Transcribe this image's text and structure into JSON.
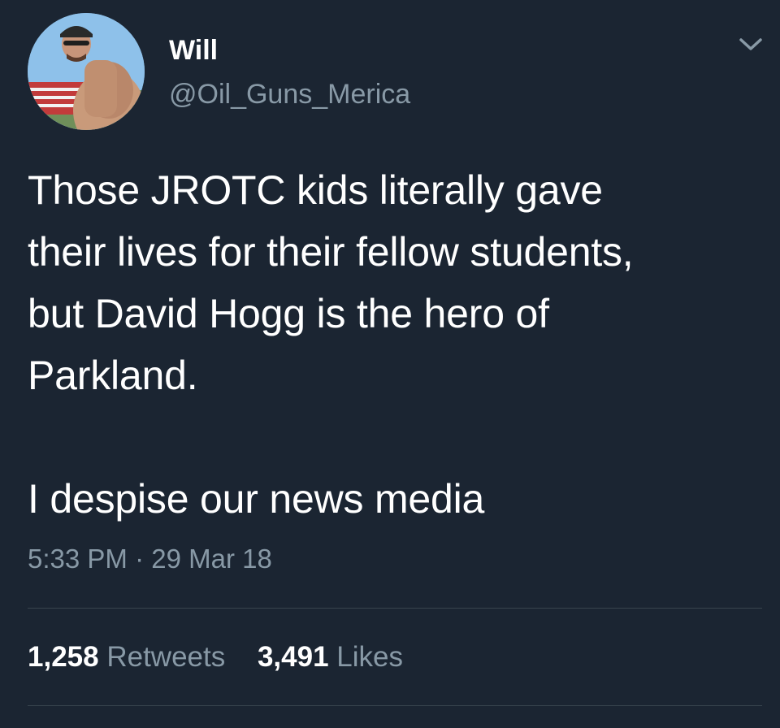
{
  "user": {
    "display_name": "Will",
    "handle": "@Oil_Guns_Merica",
    "avatar_icon": "profile-photo"
  },
  "menu": {
    "icon": "chevron-down-icon"
  },
  "tweet": {
    "lines": [
      "Those JROTC kids literally gave",
      "their lives for their fellow students,",
      "but David Hogg is the hero of",
      "Parkland.",
      "I despise our news media"
    ],
    "timestamp": "5:33 PM · 29 Mar 18"
  },
  "stats": {
    "retweets_count": "1,258",
    "retweets_label": "Retweets",
    "likes_count": "3,491",
    "likes_label": "Likes"
  },
  "colors": {
    "background": "#1b2532",
    "text_primary": "#ffffff",
    "text_secondary": "#8899a6",
    "divider": "#38444d"
  }
}
